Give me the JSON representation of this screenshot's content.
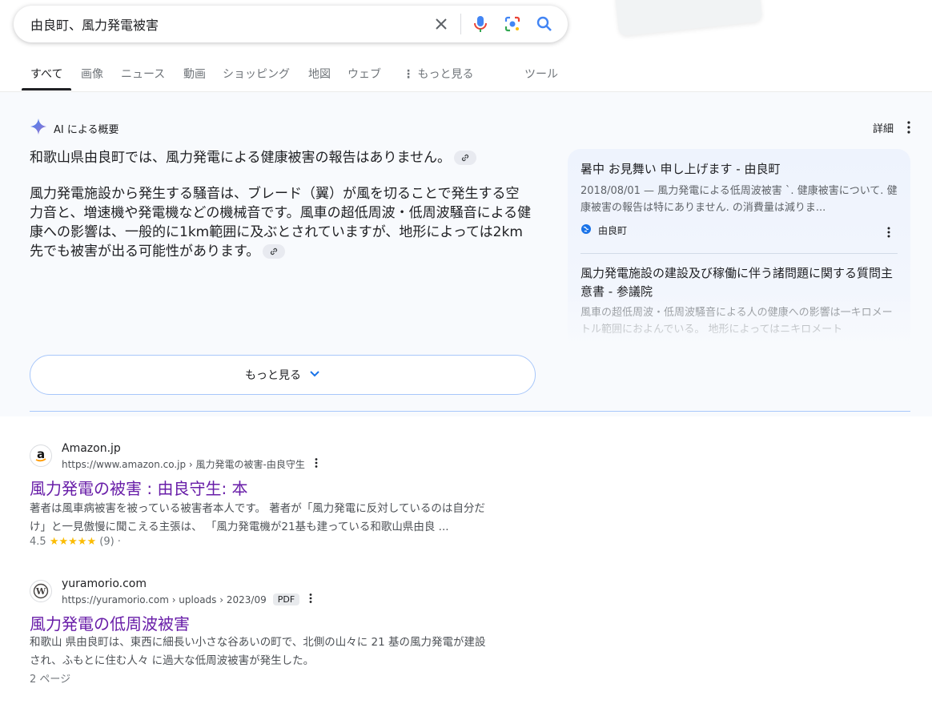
{
  "search": {
    "query": "由良町、風力発電被害"
  },
  "tabs": [
    {
      "label": "すべて"
    },
    {
      "label": "画像"
    },
    {
      "label": "ニュース"
    },
    {
      "label": "動画"
    },
    {
      "label": "ショッピング"
    },
    {
      "label": "地図"
    },
    {
      "label": "ウェブ"
    },
    {
      "label": "もっと見る"
    },
    {
      "label": "ツール"
    }
  ],
  "ai_overview": {
    "label": "AI による概要",
    "detail_label": "詳細",
    "paragraph1": "和歌山県由良町では、風力発電による健康被害の報告はありません。",
    "paragraph2": "風力発電施設から発生する騒音は、ブレード（翼）が風を切ることで発生する空力音と、増速機や発電機などの機械音です。風車の超低周波・低周波騒音による健康への影響は、一般的に1km範囲に及ぶとされていますが、地形によっては2km先でも被害が出る可能性があります。",
    "more_label": "もっと見る",
    "sources": [
      {
        "title": "暑中 お見舞い 申し上げます - 由良町",
        "snippet": "2018/08/01 — 風力発電による低周波被害 `. 健康被害について. 健康被害の報告は特にありません. の消費量は減りま...",
        "site": "由良町"
      },
      {
        "title": "風力発電施設の建設及び稼働に伴う諸問題に関する質問主意書 - 参議院",
        "snippet": "風車の超低周波・低周波騒音による人の健康への影響は一キロメートル範囲におよんでいる。 地形によってはニキロメート"
      }
    ]
  },
  "results": [
    {
      "site_name": "Amazon.jp",
      "url": "https://www.amazon.co.jp › 風力発電の被害-由良守生",
      "title": "風力発電の被害 : 由良守生: 本",
      "snippet_line1": "著者は風車病被害を被っている被害者本人です。 著者が「風力発電に反対しているのは自分だ",
      "snippet_line2": "け」と一見傲慢に聞こえる主張は、 「風力発電機が21基も建っている和歌山県由良 ...",
      "rating": "4.5",
      "stars": "★★★★★",
      "review_count": "(9) ·"
    },
    {
      "site_name": "yuramorio.com",
      "url": "https://yuramorio.com › uploads › 2023/09",
      "badge": "PDF",
      "title": "風力発電の低周波被害",
      "snippet_line1": "和歌山 県由良町は、東西に細長い小さな谷あいの町で、北側の山々に 21 基の風力発電が建設",
      "snippet_line2": "され、ふもとに住む人々 に過大な低周波被害が発生した。",
      "meta": "2 ページ"
    }
  ],
  "colors": {
    "link_visited": "#681da8",
    "ai_background": "#f8fafd",
    "accent_blue": "#a8c7fa",
    "star": "#fbbc04"
  }
}
